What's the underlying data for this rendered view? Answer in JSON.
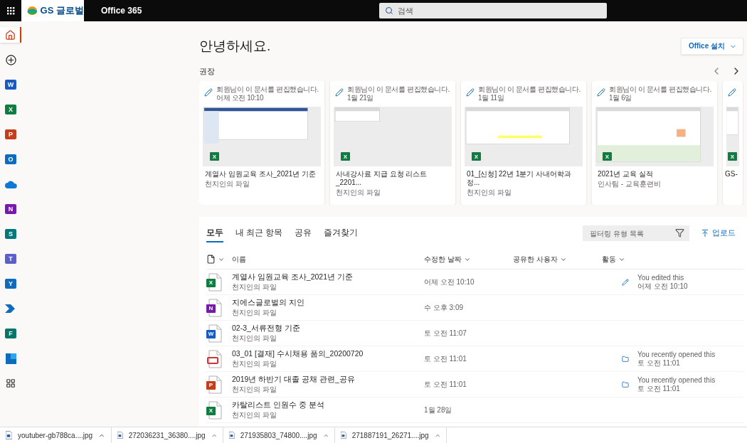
{
  "topbar": {
    "brand": "GS 글로벌",
    "product": "Office 365",
    "search": {
      "placeholder": "검색"
    }
  },
  "rail": [
    {
      "kind": "home",
      "selected": true
    },
    {
      "kind": "create",
      "selected": false
    },
    {
      "kind": "app",
      "letter": "W",
      "color": "#185abd",
      "selected": false
    },
    {
      "kind": "app",
      "letter": "X",
      "color": "#107c41",
      "selected": false
    },
    {
      "kind": "app",
      "letter": "P",
      "color": "#c43e1c",
      "selected": false
    },
    {
      "kind": "app",
      "letter": "O",
      "color": "#0f6cbd",
      "selected": false
    },
    {
      "kind": "cloud",
      "selected": false
    },
    {
      "kind": "app",
      "letter": "N",
      "color": "#7719aa",
      "selected": false
    },
    {
      "kind": "app",
      "letter": "S",
      "color": "#03787c",
      "selected": false
    },
    {
      "kind": "app",
      "letter": "T",
      "color": "#5b5fc7",
      "selected": false
    },
    {
      "kind": "app",
      "letter": "Y",
      "color": "#0f6cbd",
      "selected": false
    },
    {
      "kind": "automate",
      "selected": false
    },
    {
      "kind": "app",
      "letter": "F",
      "color": "#077568",
      "selected": false
    },
    {
      "kind": "tile",
      "selected": false
    },
    {
      "kind": "apps",
      "selected": false
    }
  ],
  "greeting": "안녕하세요.",
  "install_button": "Office 설치",
  "recommended_title": "권장",
  "cards": [
    {
      "action": "회원님이 이 문서를 편집했습니다.",
      "time": "어제 오전 10:10",
      "badge": "X",
      "title": "계열사 임원교육 조사_2021년 기준",
      "owner": "천지인의 파일"
    },
    {
      "action": "회원님이 이 문서를 편집했습니다.",
      "time": "1월 21일",
      "badge": "X",
      "title": "사내강사료 지급 요청 리스트_2201...",
      "owner": "천지인의 파일"
    },
    {
      "action": "회원님이 이 문서를 편집했습니다.",
      "time": "1월 11일",
      "badge": "X",
      "title": "01_[신청] 22년 1분기 사내어학과정...",
      "owner": "천지인의 파일"
    },
    {
      "action": "회원님이 이 문서를 편집했습니다.",
      "time": "1월 6일",
      "badge": "X",
      "title": "2021년 교육 실적",
      "owner": "인사팀 - 교육훈련비"
    },
    {
      "badge": "X",
      "title": "GS-"
    }
  ],
  "tabs": [
    {
      "label": "모두",
      "selected": true
    },
    {
      "label": "내 최근 항목",
      "selected": false
    },
    {
      "label": "공유",
      "selected": false
    },
    {
      "label": "즐겨찾기",
      "selected": false
    }
  ],
  "filter": {
    "placeholder": "필터링 유형 목록"
  },
  "upload_button": "업로드",
  "columns": [
    "이름",
    "수정한 날짜",
    "공유한 사용자",
    "활동"
  ],
  "files": [
    {
      "kind": "excel",
      "badge": "X",
      "name": "계열사 임원교육 조사_2021년 기준",
      "owner": "천지인의 파일",
      "modified": "어제 오전 10:10",
      "activity": {
        "kind": "edit",
        "text": "You edited this",
        "time": "어제 오전 10:10"
      }
    },
    {
      "kind": "onenote",
      "badge": "N",
      "name": "지에스글로벌의 지인",
      "owner": "천지인의 파일",
      "modified": "수 오후 3:09"
    },
    {
      "kind": "word",
      "badge": "W",
      "name": "02-3_서류전형 기준",
      "owner": "천지인의 파일",
      "modified": "토 오전 11:07"
    },
    {
      "kind": "pdf",
      "name": "03_01 [결재] 수시채용 품의_20200720",
      "owner": "천지인의 파일",
      "modified": "토 오전 11:01",
      "activity": {
        "kind": "open",
        "text": "You recently opened this",
        "time": "토 오전 11:01"
      }
    },
    {
      "kind": "powerpoint",
      "badge": "P",
      "name": "2019년 하반기 대졸 공채 관련_공유",
      "owner": "천지인의 파일",
      "modified": "토 오전 11:01",
      "activity": {
        "kind": "open",
        "text": "You recently opened this",
        "time": "토 오전 11:01"
      }
    },
    {
      "kind": "excel",
      "badge": "X",
      "name": "카탈리스트 인원수 중 분석",
      "owner": "천지인의 파일",
      "modified": "1월 28일"
    }
  ],
  "downloads": [
    "youtuber-gb788ca....jpg",
    "272036231_36380....jpg",
    "271935803_74800....jpg",
    "271887191_26271....jpg"
  ]
}
